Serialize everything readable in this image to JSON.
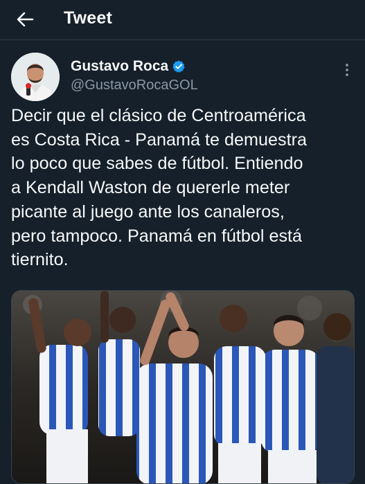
{
  "header": {
    "title": "Tweet",
    "back_icon": "arrow-left-icon"
  },
  "tweet": {
    "author": {
      "name": "Gustavo Roca",
      "handle": "@GustavoRocaGOL",
      "verified": true,
      "verified_icon": "verified-badge-icon",
      "avatar_icon": "profile-photo"
    },
    "more_icon": "more-vertical-icon",
    "text": "Decir que el clásico de Centroamérica\nes Costa Rica - Panamá te demuestra\nlo poco que sabes de fútbol. Entiendo\na Kendall Waston de quererle meter\npicante al juego ante los canaleros,\npero tampoco. Panamá en fútbol está\ntiernito.",
    "media": {
      "type": "photo",
      "description_icon": "team-celebration-photo"
    }
  },
  "colors": {
    "background": "#15202b",
    "text_primary": "#f7f9f9",
    "text_secondary": "#8b98a5",
    "verified_blue": "#1d9bf0",
    "divider": "#2f3a45"
  }
}
